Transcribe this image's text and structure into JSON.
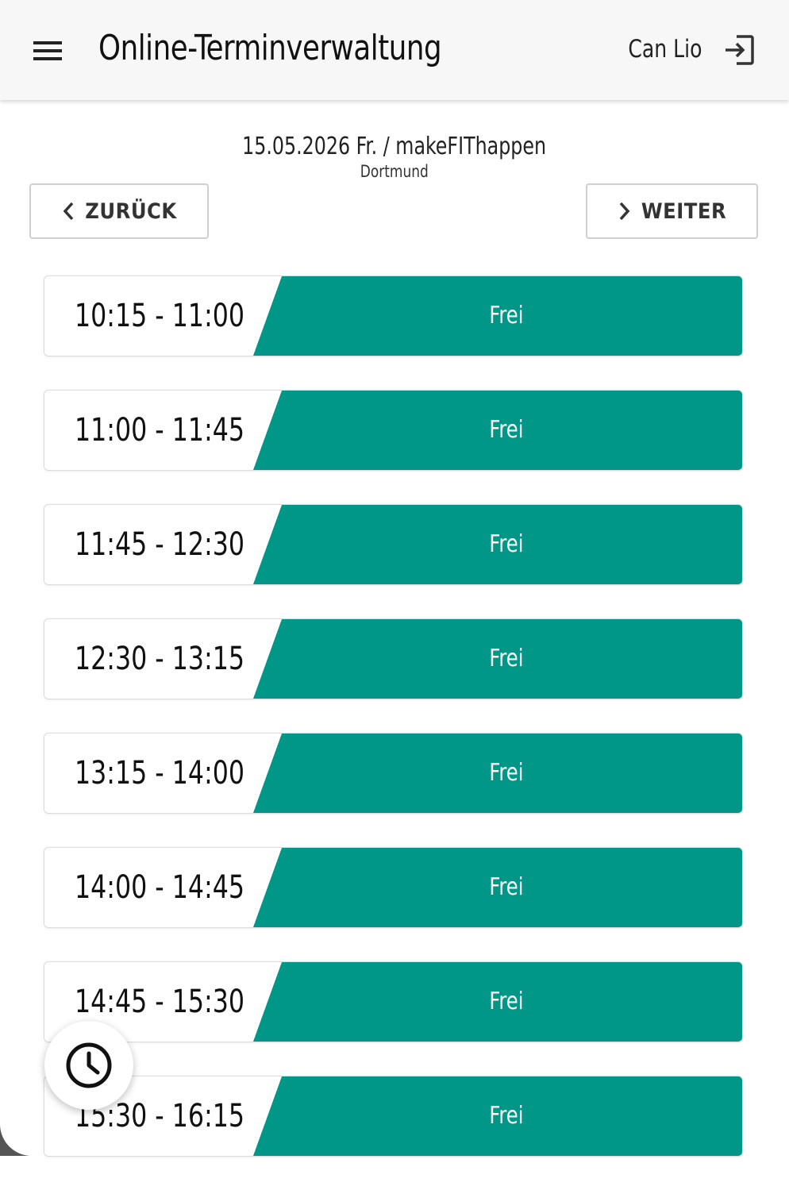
{
  "header": {
    "title": "Online-Terminverwaltung",
    "user_name": "Can Lio",
    "menu_icon": "hamburger-menu-icon",
    "logout_icon": "logout-icon"
  },
  "schedule": {
    "date_line": "15.05.2026 Fr. / makeFIThappen",
    "location": "Dortmund"
  },
  "nav": {
    "back_label": "ZURÜCK",
    "next_label": "WEITER"
  },
  "slots": [
    {
      "time": "10:15 - 11:00",
      "status": "Frei"
    },
    {
      "time": "11:00 - 11:45",
      "status": "Frei"
    },
    {
      "time": "11:45 - 12:30",
      "status": "Frei"
    },
    {
      "time": "12:30 - 13:15",
      "status": "Frei"
    },
    {
      "time": "13:15 - 14:00",
      "status": "Frei"
    },
    {
      "time": "14:00 - 14:45",
      "status": "Frei"
    },
    {
      "time": "14:45 - 15:30",
      "status": "Frei"
    },
    {
      "time": "15:30 - 16:15",
      "status": "Frei"
    }
  ],
  "fab": {
    "icon": "clock-icon"
  },
  "colors": {
    "free": "#009688",
    "appbar": "#f7f7f7"
  }
}
